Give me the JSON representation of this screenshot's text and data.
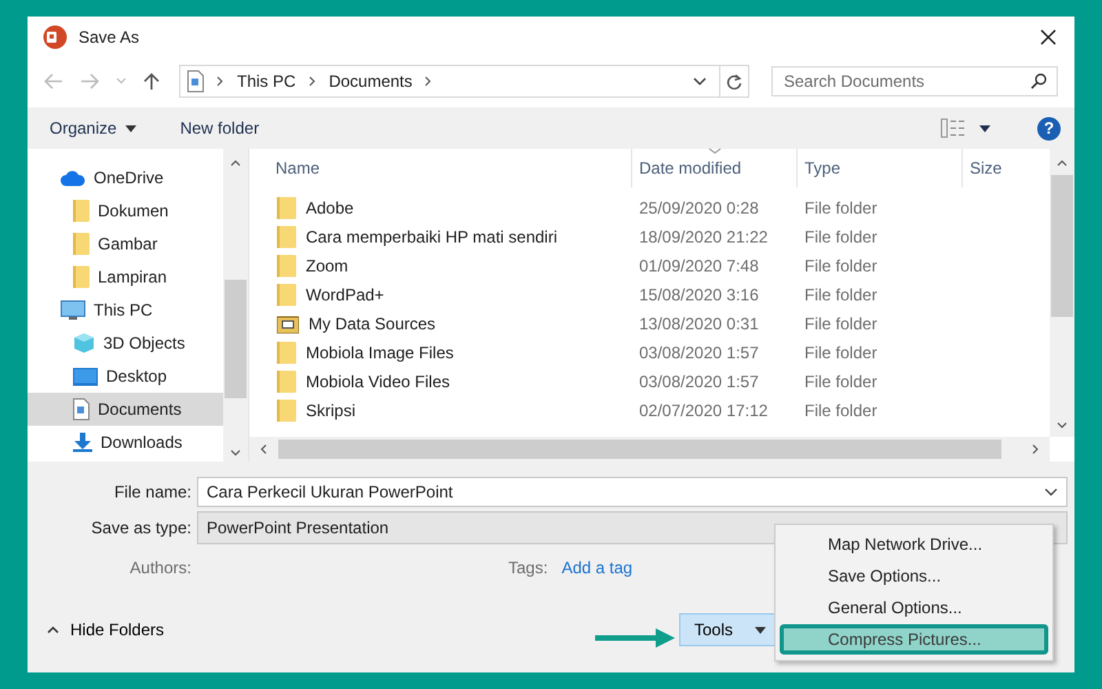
{
  "window": {
    "title": "Save As"
  },
  "nav": {
    "breadcrumb": [
      "This PC",
      "Documents"
    ],
    "search": {
      "placeholder": "Search Documents"
    }
  },
  "toolbar": {
    "organize": "Organize",
    "new_folder": "New folder",
    "help": "?"
  },
  "sidebar": {
    "items": [
      {
        "label": "OneDrive",
        "kind": "cloud",
        "selected": false,
        "children": [
          {
            "label": "Dokumen",
            "kind": "folder",
            "selected": false
          },
          {
            "label": "Gambar",
            "kind": "folder",
            "selected": false
          },
          {
            "label": "Lampiran",
            "kind": "folder",
            "selected": false
          }
        ]
      },
      {
        "label": "This PC",
        "kind": "pc",
        "selected": false,
        "children": [
          {
            "label": "3D Objects",
            "kind": "cube",
            "selected": false
          },
          {
            "label": "Desktop",
            "kind": "desktop",
            "selected": false
          },
          {
            "label": "Documents",
            "kind": "document",
            "selected": true
          },
          {
            "label": "Downloads",
            "kind": "download",
            "selected": false
          }
        ]
      }
    ]
  },
  "table": {
    "columns": [
      "Name",
      "Date modified",
      "Type",
      "Size"
    ],
    "rows": [
      {
        "name": "Adobe",
        "kind": "folder",
        "date": "25/09/2020 0:28",
        "type": "File folder"
      },
      {
        "name": "Cara memperbaiki HP mati sendiri",
        "kind": "folder",
        "date": "18/09/2020 21:22",
        "type": "File folder"
      },
      {
        "name": "Zoom",
        "kind": "folder",
        "date": "01/09/2020 7:48",
        "type": "File folder"
      },
      {
        "name": "WordPad+",
        "kind": "folder",
        "date": "15/08/2020 3:16",
        "type": "File folder"
      },
      {
        "name": "My Data Sources",
        "kind": "datasource",
        "date": "13/08/2020 0:31",
        "type": "File folder"
      },
      {
        "name": "Mobiola Image Files",
        "kind": "folder",
        "date": "03/08/2020 1:57",
        "type": "File folder"
      },
      {
        "name": "Mobiola Video Files",
        "kind": "folder",
        "date": "03/08/2020 1:57",
        "type": "File folder"
      },
      {
        "name": "Skripsi",
        "kind": "folder",
        "date": "02/07/2020 17:12",
        "type": "File folder"
      }
    ]
  },
  "form": {
    "file_name": {
      "label": "File name:",
      "value": "Cara Perkecil Ukuran PowerPoint"
    },
    "save_as_type": {
      "label": "Save as type:",
      "value": "PowerPoint Presentation"
    },
    "authors": {
      "label": "Authors:"
    },
    "tags": {
      "label": "Tags:",
      "link": "Add a tag"
    }
  },
  "hide_folders": "Hide Folders",
  "tools_button": {
    "label": "Tools"
  },
  "tools_menu": {
    "items": [
      {
        "label": "Map Network Drive...",
        "selected": false
      },
      {
        "label": "Save Options...",
        "selected": false
      },
      {
        "label": "General Options...",
        "selected": false
      },
      {
        "label": "Compress Pictures...",
        "selected": true
      }
    ]
  }
}
